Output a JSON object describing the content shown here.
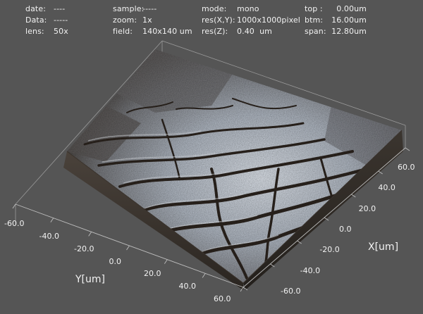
{
  "header": {
    "col1": [
      {
        "label": "date:",
        "value": "----"
      },
      {
        "label": "Data:",
        "value": "-----"
      },
      {
        "label": "lens:",
        "value": "50x"
      }
    ],
    "col2": [
      {
        "label": "sample:",
        "value": "-----"
      },
      {
        "label": "zoom:",
        "value": "1x"
      },
      {
        "label": "field:",
        "value": "140x140 um"
      }
    ],
    "col3": [
      {
        "label": "mode:",
        "value": "mono"
      },
      {
        "label": "res(X,Y):",
        "value": "1000x1000pixel"
      },
      {
        "label": "res(Z):",
        "value": "0.40  um"
      }
    ],
    "col4": [
      {
        "label": "top :",
        "value": "0.00um"
      },
      {
        "label": "btm:",
        "value": "16.00um"
      },
      {
        "label": "span:",
        "value": "12.80um"
      }
    ]
  },
  "axes": {
    "x_title": "X[um]",
    "y_title": "Y[um]",
    "x_ticks": [
      "60.0",
      "40.0",
      "20.0",
      "0.0",
      "-20.0",
      "-40.0",
      "-60.0"
    ],
    "y_ticks": [
      "-60.0",
      "-40.0",
      "-20.0",
      "0.0",
      "20.0",
      "40.0",
      "60.0"
    ]
  },
  "colors": {
    "background": "#555555",
    "text": "#f2f2f2",
    "surface_light": "#dde4ee",
    "surface_dark": "#3a332d"
  }
}
